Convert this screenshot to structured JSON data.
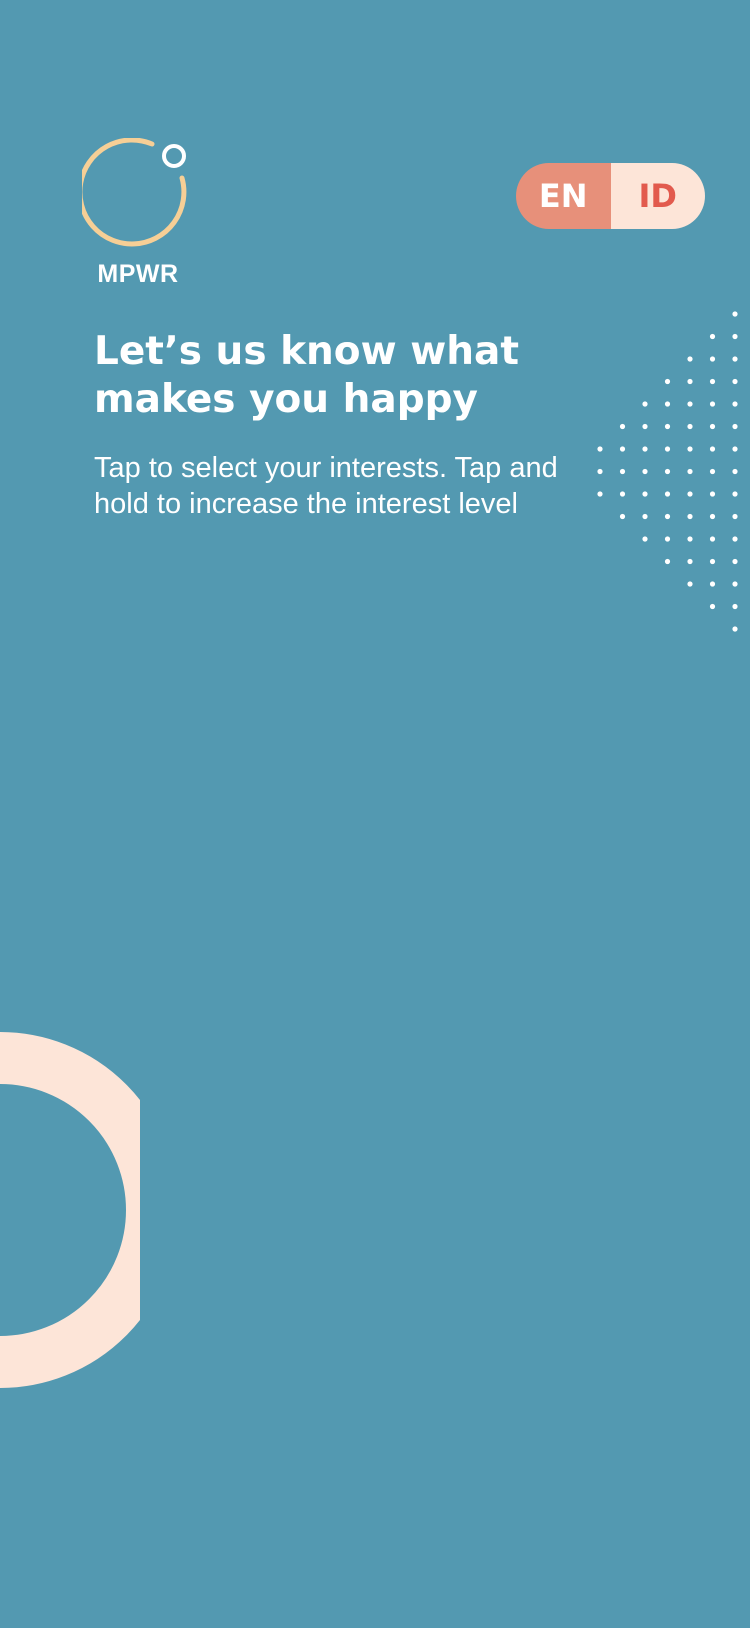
{
  "app": {
    "logo_text": "MPWR"
  },
  "language_toggle": {
    "options": [
      {
        "code": "EN",
        "selected": true
      },
      {
        "code": "ID",
        "selected": false
      }
    ]
  },
  "onboarding": {
    "title": "Let’s us know what makes you happy",
    "subtitle": "Tap to select your interests. Tap and hold to increase the interest level"
  },
  "colors": {
    "background": "#5399b1",
    "logo_ring": "#f6cf96",
    "toggle_en_bg": "#e7907a",
    "toggle_id_bg": "#fde5d8",
    "toggle_id_text": "#e25a4d",
    "decor_ring": "#fde5d8"
  }
}
